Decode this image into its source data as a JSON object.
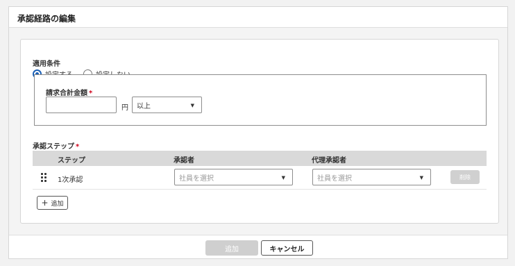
{
  "dialog": {
    "title": "承認経路の編集"
  },
  "conditions": {
    "label": "適用条件",
    "options": [
      {
        "label": "設定する",
        "checked": true
      },
      {
        "label": "設定しない",
        "checked": false
      }
    ],
    "amount": {
      "label": "請求合計金額",
      "required_mark": "*",
      "value": "",
      "unit": "円",
      "comparison": "以上"
    }
  },
  "steps": {
    "label": "承認ステップ",
    "required_mark": "*",
    "columns": [
      "ステップ",
      "承認者",
      "代理承認者"
    ],
    "rows": [
      {
        "name": "1次承認",
        "approver_placeholder": "社員を選択",
        "proxy_placeholder": "社員を選択",
        "delete_label": "削除"
      }
    ],
    "add_label": "追加",
    "add_icon": "plus-icon"
  },
  "footer": {
    "add_label": "追加",
    "cancel_label": "キャンセル"
  },
  "colors": {
    "accent": "#1a5fb4",
    "required": "#d0021b",
    "disabled": "#cfcfcf"
  }
}
